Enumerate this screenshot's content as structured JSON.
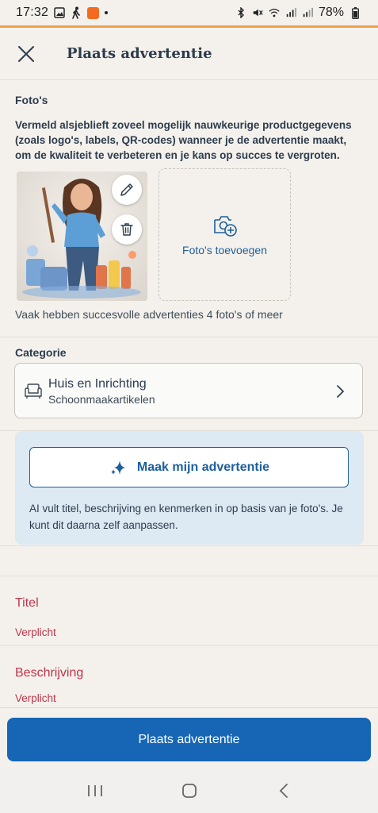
{
  "status": {
    "time": "17:32",
    "battery": "78%"
  },
  "header": {
    "title": "Plaats advertentie"
  },
  "photos": {
    "label": "Foto's",
    "description": "Vermeld alsjeblieft zoveel mogelijk nauwkeurige productgegevens (zoals logo's, labels, QR-codes) wanneer je de advertentie maakt, om de kwaliteit te verbeteren en je kans op succes te vergroten.",
    "add_label": "Foto's toevoegen",
    "hint": "Vaak hebben succesvolle advertenties 4 foto's of meer"
  },
  "category": {
    "label": "Categorie",
    "title": "Huis en Inrichting",
    "subtitle": "Schoonmaakartikelen"
  },
  "ai": {
    "button_label": "Maak mijn advertentie",
    "text": "AI vult titel, beschrijving en kenmerken in op basis van je foto's. Je kunt dit daarna zelf aanpassen."
  },
  "fields": {
    "title": {
      "label": "Titel",
      "required": "Verplicht"
    },
    "description": {
      "label": "Beschrijving",
      "required": "Verplicht"
    }
  },
  "bottom": {
    "submit_label": "Plaats advertentie"
  },
  "colors": {
    "primary": "#1666b5",
    "error": "#c0344a",
    "accent": "#f0a04b",
    "ai_panel": "#dde9f3"
  }
}
